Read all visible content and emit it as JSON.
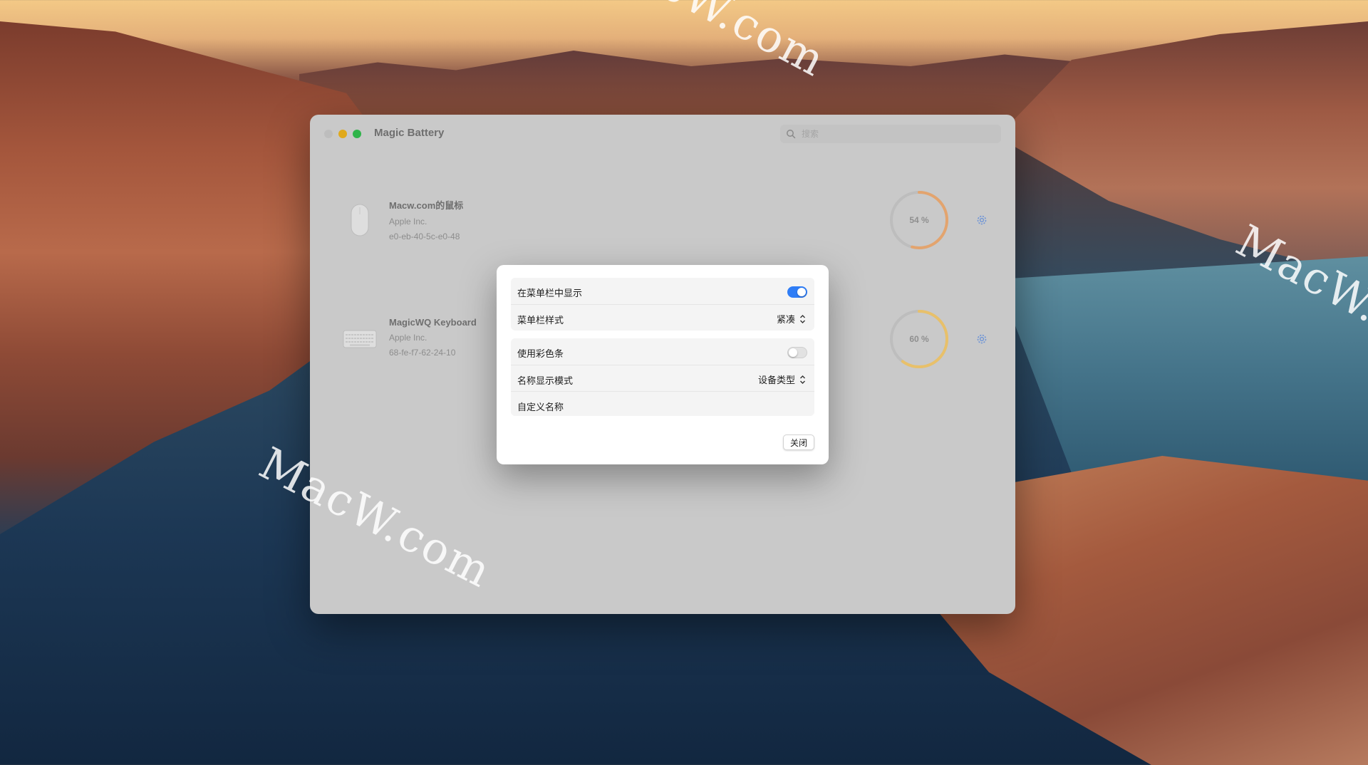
{
  "watermarks": [
    "MacW.com",
    "MacW.com",
    "MacW.com"
  ],
  "app": {
    "title": "Magic Battery"
  },
  "search": {
    "placeholder": "搜索"
  },
  "devices": [
    {
      "name": "Macw.com的鼠标",
      "vendor": "Apple Inc.",
      "mac": "e0-eb-40-5c-e0-48",
      "battery_label": "54 %",
      "battery_level": 0.54,
      "icon": "mouse-icon",
      "ring_color": "#e3a46e"
    },
    {
      "name": "MagicWQ Keyboard",
      "vendor": "Apple Inc.",
      "mac": "68-fe-f7-62-24-10",
      "battery_label": "60 %",
      "battery_level": 0.6,
      "icon": "keyboard-icon",
      "ring_color": "#e8c06a"
    }
  ],
  "modal": {
    "show_in_menubar": {
      "label": "在菜单栏中显示",
      "on": true
    },
    "menubar_style": {
      "label": "菜单栏样式",
      "value": "紧凑"
    },
    "use_color_bar": {
      "label": "使用彩色条",
      "on": false
    },
    "name_display_mode": {
      "label": "名称显示模式",
      "value": "设备类型"
    },
    "custom_name": {
      "label": "自定义名称"
    },
    "close_label": "关闭"
  },
  "colors": {
    "accent": "#2f7df6",
    "gear": "#6f95d6"
  }
}
